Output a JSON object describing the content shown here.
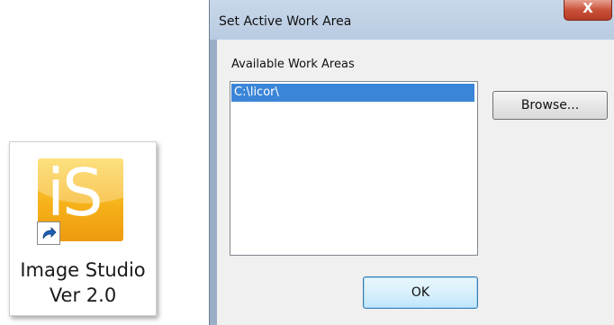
{
  "shortcut": {
    "icon_letters": "iS",
    "label_line1": "Image Studio",
    "label_line2": "Ver 2.0"
  },
  "dialog": {
    "title": "Set Active Work Area",
    "close_label": "X",
    "list_label": "Available Work Areas",
    "work_areas": [
      "C:\\licor\\"
    ],
    "selected_index": 0,
    "browse_label": "Browse...",
    "ok_label": "OK"
  },
  "colors": {
    "selection": "#3a85d8",
    "close_button": "#c9513a",
    "app_icon": "#f6b21a"
  },
  "icons": [
    "image-studio-app-icon",
    "shortcut-arrow-icon",
    "close-icon"
  ]
}
